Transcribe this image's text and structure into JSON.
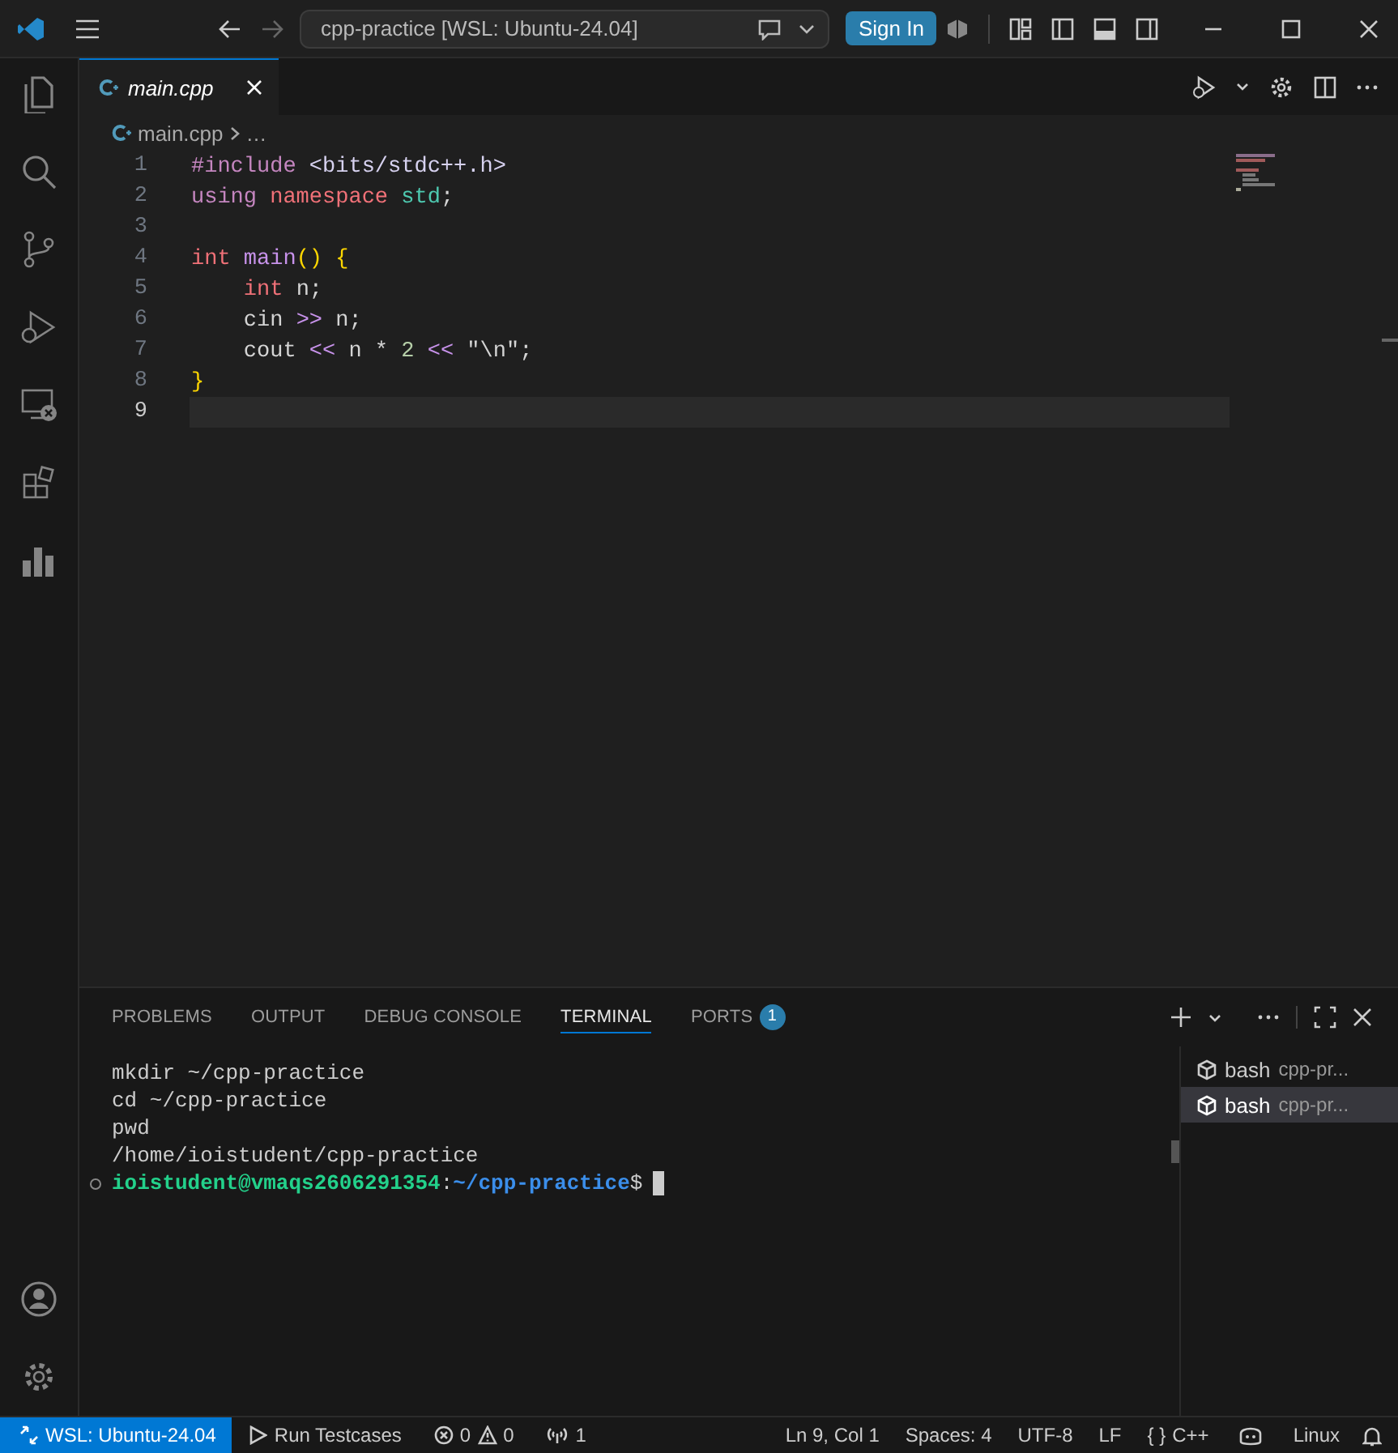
{
  "title_bar": {
    "search_text": "cpp-practice [WSL: Ubuntu-24.04]",
    "sign_in": "Sign In"
  },
  "editor_tabs": [
    {
      "label": "main.cpp",
      "selected": true
    }
  ],
  "breadcrumb": {
    "file": "main.cpp",
    "more": "…"
  },
  "code_lines": [
    {
      "number": "1",
      "selected": false,
      "tokens": [
        {
          "text": "#include ",
          "kind": "directive"
        },
        {
          "text": "<bits/stdc++.h>",
          "kind": "header"
        }
      ]
    },
    {
      "number": "2",
      "selected": false,
      "tokens": [
        {
          "text": "using ",
          "kind": "directive"
        },
        {
          "text": "namespace ",
          "kind": "keyword"
        },
        {
          "text": "std",
          "kind": "type"
        },
        {
          "text": ";",
          "kind": "plain"
        }
      ]
    },
    {
      "number": "3",
      "selected": false
    },
    {
      "number": "4",
      "selected": false,
      "tokens": [
        {
          "text": "int ",
          "kind": "keyword"
        },
        {
          "text": "main",
          "kind": "function"
        },
        {
          "text": "() {",
          "kind": "bracket"
        }
      ]
    },
    {
      "number": "5",
      "selected": false,
      "tokens": [
        {
          "text": "    int",
          "kind": "keyword"
        },
        {
          "text": " n;",
          "kind": "plain"
        }
      ]
    },
    {
      "number": "6",
      "selected": false,
      "tokens": [
        {
          "text": "    cin ",
          "kind": "plain"
        },
        {
          "text": ">>",
          "kind": "operator"
        },
        {
          "text": " n;",
          "kind": "plain"
        }
      ]
    },
    {
      "number": "7",
      "selected": false,
      "tokens": [
        {
          "text": "    cout ",
          "kind": "plain"
        },
        {
          "text": "<<",
          "kind": "operator"
        },
        {
          "text": " n * ",
          "kind": "plain"
        },
        {
          "text": "2",
          "kind": "number"
        },
        {
          "text": " <<",
          "kind": "operator"
        },
        {
          "text": " \"\\n\";",
          "kind": "plain"
        }
      ]
    },
    {
      "number": "8",
      "selected": false,
      "tokens": [
        {
          "text": "}",
          "kind": "bracket"
        }
      ]
    },
    {
      "number": "9",
      "selected": true
    }
  ],
  "panel": {
    "tabs": [
      {
        "label": "PROBLEMS",
        "selected": false
      },
      {
        "label": "OUTPUT",
        "selected": false
      },
      {
        "label": "DEBUG CONSOLE",
        "selected": false
      },
      {
        "label": "TERMINAL",
        "selected": true
      },
      {
        "label": "PORTS",
        "selected": false,
        "badge": "1"
      }
    ],
    "terminal_lines": [
      {
        "kind": "output",
        "text": "mkdir ~/cpp-practice"
      },
      {
        "kind": "output",
        "text": "cd ~/cpp-practice"
      },
      {
        "kind": "output",
        "text": "pwd"
      },
      {
        "kind": "output",
        "text": "/home/ioistudent/cpp-practice"
      },
      {
        "kind": "prompt",
        "user": "ioistudent@vmaqs2606291354",
        "separator": ":",
        "path": "~/cpp-practice",
        "symbol": "$"
      }
    ],
    "terminals": [
      {
        "label": "bash",
        "detail": "cpp-pr...",
        "selected": false
      },
      {
        "label": "bash",
        "detail": "cpp-pr...",
        "selected": true
      }
    ]
  },
  "status_bar": {
    "remote": "WSL: Ubuntu-24.04",
    "run": "Run Testcases",
    "errors": "0",
    "warnings": "0",
    "ports": "1",
    "position": "Ln 9, Col 1",
    "spaces": "Spaces: 4",
    "encoding": "UTF-8",
    "eol": "LF",
    "language_icon": "{ }",
    "language": "C++",
    "os": "Linux"
  }
}
